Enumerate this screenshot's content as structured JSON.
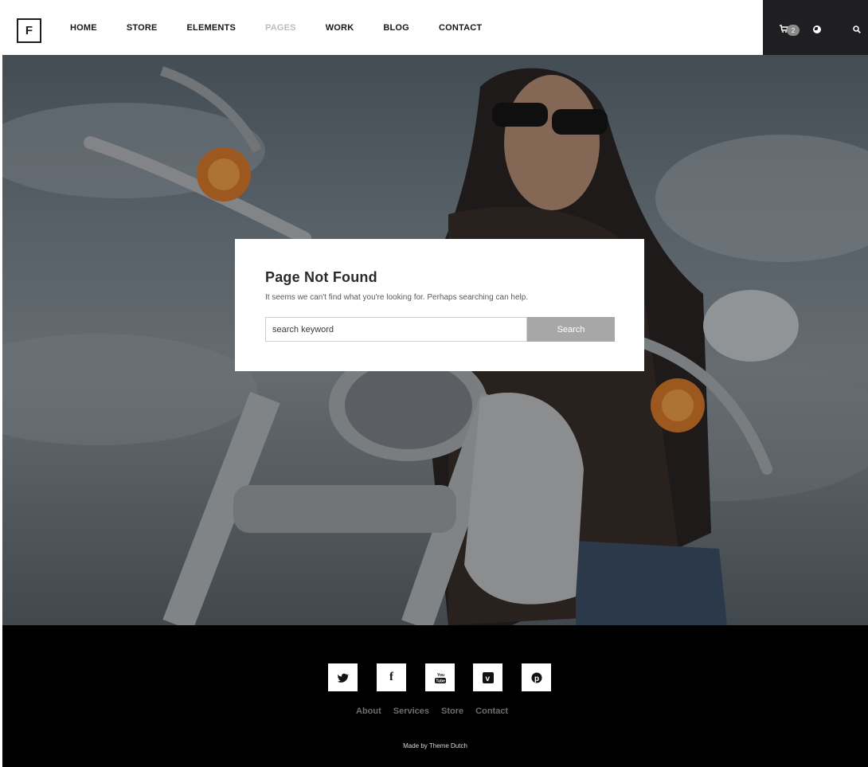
{
  "header": {
    "logo": "F",
    "nav": [
      {
        "label": "HOME"
      },
      {
        "label": "STORE"
      },
      {
        "label": "ELEMENTS"
      },
      {
        "label": "PAGES",
        "active": true
      },
      {
        "label": "WORK"
      },
      {
        "label": "BLOG"
      },
      {
        "label": "CONTACT"
      }
    ],
    "cart_count": "2",
    "icons": [
      "cart-icon",
      "globe-icon",
      "search-icon"
    ]
  },
  "not_found": {
    "title": "Page Not Found",
    "description": "It seems we can't find what you're looking for. Perhaps searching can help.",
    "search_value": "search keyword",
    "search_button": "Search"
  },
  "footer": {
    "social": [
      {
        "name": "twitter-icon",
        "glyph": "𝕥"
      },
      {
        "name": "facebook-icon",
        "glyph": "f"
      },
      {
        "name": "youtube-icon",
        "glyph": "You Tube"
      },
      {
        "name": "vimeo-icon",
        "glyph": "v"
      },
      {
        "name": "pinterest-icon",
        "glyph": "℗"
      }
    ],
    "links": [
      "About",
      "Services",
      "Store",
      "Contact"
    ],
    "credit": "Made by Theme Dutch"
  },
  "colors": {
    "header_tools_bg": "#1f1f22",
    "active_nav": "#bdbdbd",
    "search_button_bg": "#a7a7a7",
    "footer_bg": "#000000"
  }
}
